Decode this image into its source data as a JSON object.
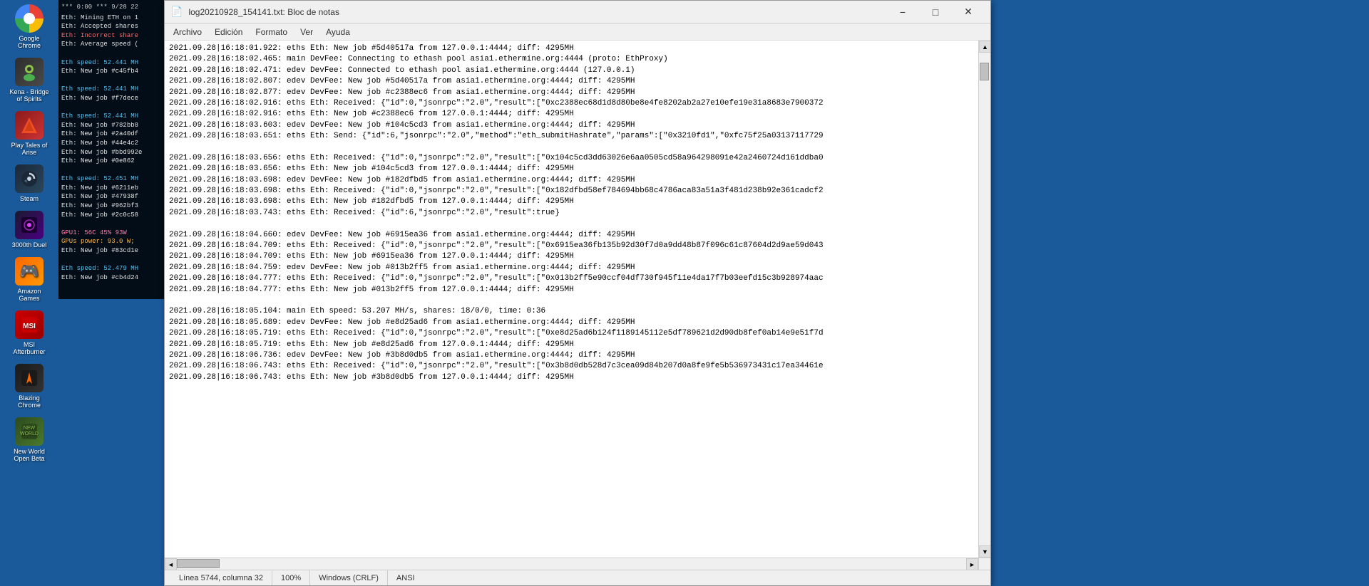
{
  "sidebar": {
    "icons": [
      {
        "id": "google-chrome",
        "label": "Google\nChrome",
        "emoji": "🌐"
      },
      {
        "id": "kena",
        "label": "Kena - Bridge\nof Spirits",
        "emoji": "🎮"
      },
      {
        "id": "tales-of-arise",
        "label": "Play Tales of\nArise",
        "emoji": "⚔️"
      },
      {
        "id": "steam",
        "label": "Steam",
        "emoji": "🎮"
      },
      {
        "id": "3000th-duel",
        "label": "3000th Duel",
        "emoji": "🗡️"
      },
      {
        "id": "amazon-games",
        "label": "Amazon\nGames",
        "emoji": "🎯"
      },
      {
        "id": "msi-afterburner",
        "label": "MSI\nAfterburner",
        "emoji": "🔥"
      },
      {
        "id": "blazing-chrome",
        "label": "Blazing\nChrome",
        "emoji": "💥"
      },
      {
        "id": "new-world",
        "label": "New World\nOpen Beta",
        "emoji": "🌍"
      }
    ]
  },
  "notepad": {
    "title": "log20210928_154141.txt: Bloc de notas",
    "title_icon": "📄",
    "menu": [
      "Archivo",
      "Edición",
      "Formato",
      "Ver",
      "Ayuda"
    ],
    "status": {
      "position": "Línea 5744, columna 32",
      "zoom": "100%",
      "line_endings": "Windows (CRLF)",
      "encoding": "ANSI"
    },
    "content_lines": [
      "2021.09.28|16:18:01.922: eths Eth: New job #5d40517a from 127.0.0.1:4444; diff: 4295MH",
      "2021.09.28|16:18:02.465: main DevFee: Connecting to ethash pool asia1.ethermine.org:4444 (proto: EthProxy)",
      "2021.09.28|16:18:02.471: edev DevFee: Connected to ethash pool asia1.ethermine.org:4444 (127.0.0.1)",
      "2021.09.28|16:18:02.807: edev DevFee: New job #5d40517a from asia1.ethermine.org:4444; diff: 4295MH",
      "2021.09.28|16:18:02.877: edev DevFee: New job #c2388ec6 from asia1.ethermine.org:4444; diff: 4295MH",
      "2021.09.28|16:18:02.916: eths Eth: Received: {\"id\":0,\"jsonrpc\":\"2.0\",\"result\":[\"0xc2388ec68d1d8d80be8e4fe8202ab2a27e10efe19e31a8683e7900372",
      "2021.09.28|16:18:02.916: eths Eth: New job #c2388ec6 from 127.0.0.1:4444; diff: 4295MH",
      "2021.09.28|16:18:03.603: edev DevFee: New job #104c5cd3 from asia1.ethermine.org:4444; diff: 4295MH",
      "2021.09.28|16:18:03.651: eths Eth: Send: {\"id\":6,\"jsonrpc\":\"2.0\",\"method\":\"eth_submitHashrate\",\"params\":[\"0x3210fd1\",\"0xfc75f25a03137117729",
      "",
      "2021.09.28|16:18:03.656: eths Eth: Received: {\"id\":0,\"jsonrpc\":\"2.0\",\"result\":[\"0x104c5cd3dd63026e6aa0505cd58a964298091e42a2460724d161ddba0",
      "2021.09.28|16:18:03.656: eths Eth: New job #104c5cd3 from 127.0.0.1:4444; diff: 4295MH",
      "2021.09.28|16:18:03.698: edev DevFee: New job #182dfbd5 from asia1.ethermine.org:4444; diff: 4295MH",
      "2021.09.28|16:18:03.698: eths Eth: Received: {\"id\":0,\"jsonrpc\":\"2.0\",\"result\":[\"0x182dfbd58ef784694bb68c4786aca83a51a3f481d238b92e361cadcf2",
      "2021.09.28|16:18:03.698: eths Eth: New job #182dfbd5 from 127.0.0.1:4444; diff: 4295MH",
      "2021.09.28|16:18:03.743: eths Eth: Received: {\"id\":6,\"jsonrpc\":\"2.0\",\"result\":true}",
      "",
      "2021.09.28|16:18:04.660: edev DevFee: New job #6915ea36 from asia1.ethermine.org:4444; diff: 4295MH",
      "2021.09.28|16:18:04.709: eths Eth: Received: {\"id\":0,\"jsonrpc\":\"2.0\",\"result\":[\"0x6915ea36fb135b92d30f7d0a9dd48b87f096c61c87604d2d9ae59d043",
      "2021.09.28|16:18:04.709: eths Eth: New job #6915ea36 from 127.0.0.1:4444; diff: 4295MH",
      "2021.09.28|16:18:04.759: edev DevFee: New job #013b2ff5 from asia1.ethermine.org:4444; diff: 4295MH",
      "2021.09.28|16:18:04.777: eths Eth: Received: {\"id\":0,\"jsonrpc\":\"2.0\",\"result\":[\"0x013b2ff5e90ccf04df730f945f11e4da17f7b03eefd15c3b928974aac",
      "2021.09.28|16:18:04.777: eths Eth: New job #013b2ff5 from 127.0.0.1:4444; diff: 4295MH",
      "",
      "2021.09.28|16:18:05.104: main Eth speed: 53.207 MH/s, shares: 18/0/0, time: 0:36",
      "2021.09.28|16:18:05.689: edev DevFee: New job #e8d25ad6 from asia1.ethermine.org:4444; diff: 4295MH",
      "2021.09.28|16:18:05.719: eths Eth: Received: {\"id\":0,\"jsonrpc\":\"2.0\",\"result\":[\"0xe8d25ad6b124f1189145112e5df789621d2d90db8fef0ab14e9e51f7d",
      "2021.09.28|16:18:05.719: eths Eth: New job #e8d25ad6 from 127.0.0.1:4444; diff: 4295MH",
      "2021.09.28|16:18:06.736: edev DevFee: New job #3b8d0db5 from asia1.ethermine.org:4444; diff: 4295MH",
      "2021.09.28|16:18:06.743: eths Eth: Received: {\"id\":0,\"jsonrpc\":\"2.0\",\"result\":[\"0x3b8d0db528d7c3cea09d84b207d0a8fe9fe5b536973431c17ea34461e",
      "2021.09.28|16:18:06.743: eths Eth: New job #3b8d0db5 from 127.0.0.1:4444; diff: 4295MH"
    ]
  },
  "console": {
    "header": "*** 0:00 *** 9/28 22",
    "lines": [
      {
        "text": "Eth: Mining ETH on 1",
        "color": "white"
      },
      {
        "text": "Eth: Accepted shares",
        "color": "white"
      },
      {
        "text": "Eth: Incorrect share",
        "color": "red"
      },
      {
        "text": "Eth: Average speed (",
        "color": "white"
      },
      "",
      {
        "text": "Eth speed: 52.441 MH",
        "color": "green"
      },
      {
        "text": "Eth: New job #c45fb4",
        "color": "white"
      },
      "",
      {
        "text": "Eth speed: 52.441 MH",
        "color": "green"
      },
      {
        "text": "Eth: New job #f7dece",
        "color": "white"
      },
      "",
      {
        "text": "Eth speed: 52.441 MH",
        "color": "green"
      },
      {
        "text": "Eth: New job #782bb8",
        "color": "white"
      },
      {
        "text": "Eth: New job #2a40df",
        "color": "white"
      },
      {
        "text": "Eth: New job #44e4c2",
        "color": "white"
      },
      {
        "text": "Eth: New job #bbd992e",
        "color": "white"
      },
      {
        "text": "Eth: New job #0e862",
        "color": "white"
      },
      "",
      {
        "text": "Eth speed: 52.451 MH",
        "color": "green"
      },
      {
        "text": "Eth: New job #6211eb",
        "color": "white"
      },
      {
        "text": "Eth: New job #47938f",
        "color": "white"
      },
      {
        "text": "Eth: New job #962bf3",
        "color": "white"
      },
      {
        "text": "Eth: New job #2c0c58",
        "color": "white"
      },
      "",
      {
        "text": "GPU1: 56C 45% 93W",
        "color": "pink"
      },
      {
        "text": "GPUs power: 93.0 W;",
        "color": "orange"
      },
      {
        "text": "Eth: New job #83cd1e",
        "color": "white"
      },
      "",
      {
        "text": "Eth speed: 52.479 MH",
        "color": "green"
      },
      {
        "text": "Eth: New job #cb4d24",
        "color": "white"
      }
    ]
  }
}
